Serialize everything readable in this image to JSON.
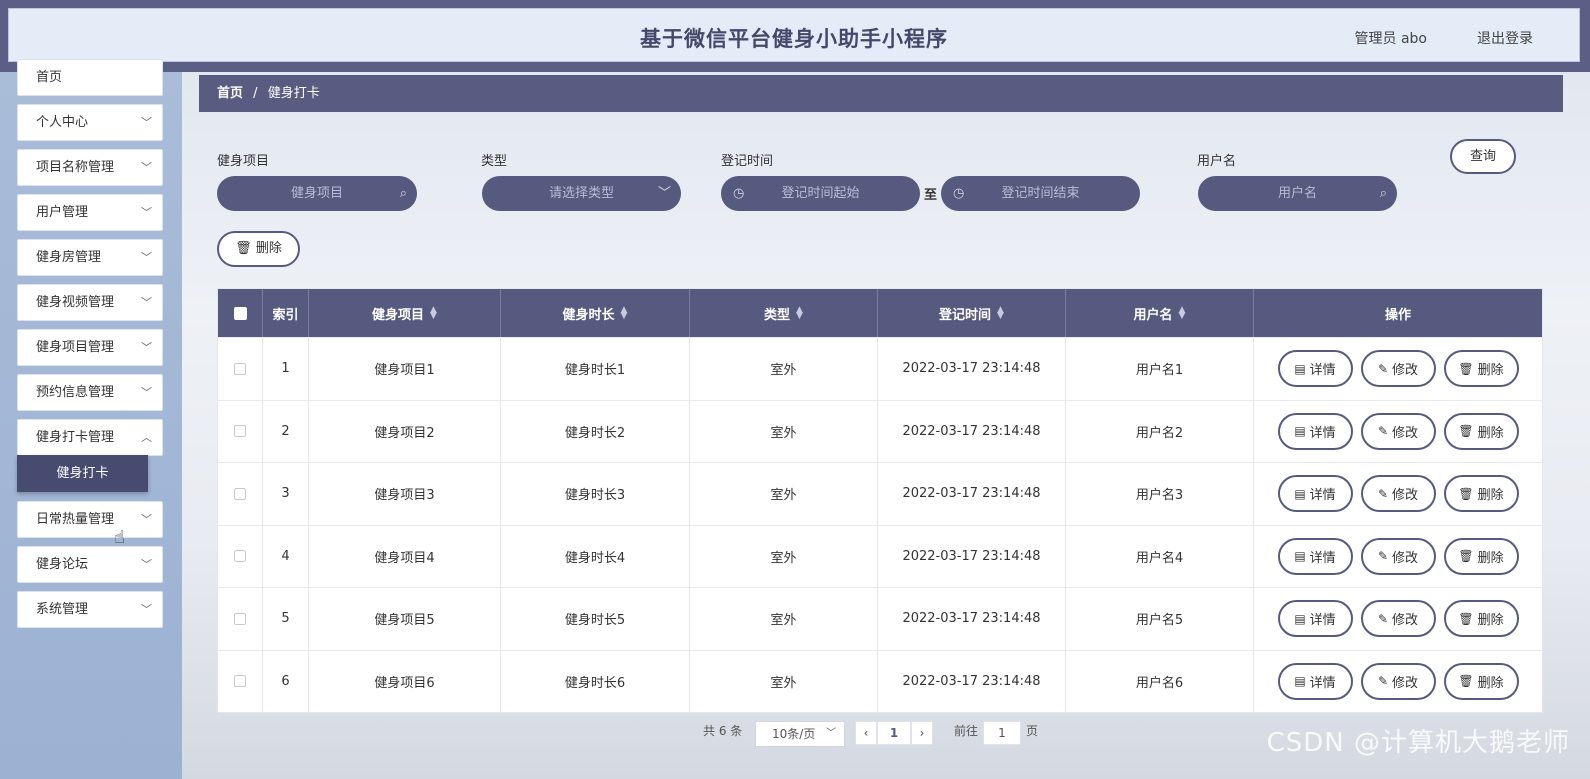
{
  "header": {
    "title": "基于微信平台健身小助手小程序",
    "user": "管理员 abo",
    "logout": "退出登录"
  },
  "sidebar": {
    "items": [
      "首页",
      "个人中心",
      "项目名称管理",
      "用户管理",
      "健身房管理",
      "健身视频管理",
      "健身项目管理",
      "预约信息管理",
      "健身打卡管理",
      "日常热量管理",
      "健身论坛",
      "系统管理"
    ],
    "sub_item": "健身打卡"
  },
  "breadcrumb": {
    "home": "首页",
    "sep": "/",
    "current": "健身打卡"
  },
  "filters": {
    "project_label": "健身项目",
    "project_placeholder": "健身项目",
    "type_label": "类型",
    "type_placeholder": "请选择类型",
    "time_label": "登记时间",
    "time_start": "登记时间起始",
    "time_to": "至",
    "time_end": "登记时间结束",
    "user_label": "用户名",
    "user_placeholder": "用户名",
    "query": "查询",
    "delete": "删除"
  },
  "table": {
    "headers": [
      "索引",
      "健身项目",
      "健身时长",
      "类型",
      "登记时间",
      "用户名",
      "操作"
    ],
    "rows": [
      [
        "1",
        "健身项目1",
        "健身时长1",
        "室外",
        "2022-03-17 23:14:48",
        "用户名1"
      ],
      [
        "2",
        "健身项目2",
        "健身时长2",
        "室外",
        "2022-03-17 23:14:48",
        "用户名2"
      ],
      [
        "3",
        "健身项目3",
        "健身时长3",
        "室外",
        "2022-03-17 23:14:48",
        "用户名3"
      ],
      [
        "4",
        "健身项目4",
        "健身时长4",
        "室外",
        "2022-03-17 23:14:48",
        "用户名4"
      ],
      [
        "5",
        "健身项目5",
        "健身时长5",
        "室外",
        "2022-03-17 23:14:48",
        "用户名5"
      ],
      [
        "6",
        "健身项目6",
        "健身时长6",
        "室外",
        "2022-03-17 23:14:48",
        "用户名6"
      ]
    ],
    "actions": {
      "detail": "详情",
      "edit": "修改",
      "delete": "删除"
    }
  },
  "pagination": {
    "total": "共 6 条",
    "page_size": "10条/页",
    "current": "1",
    "goto": "前往",
    "goto_value": "1",
    "page_unit": "页"
  },
  "watermark": "CSDN @计算机大鹅老师",
  "colors": {
    "primary": "#575a7f",
    "topbar": "#5b5f85",
    "sidebar": "#a9bcd8"
  },
  "icons": [
    "search-icon",
    "chevron-down-icon",
    "clock-icon",
    "trash-icon",
    "document-icon",
    "pencil-icon",
    "pointer-cursor-icon"
  ]
}
